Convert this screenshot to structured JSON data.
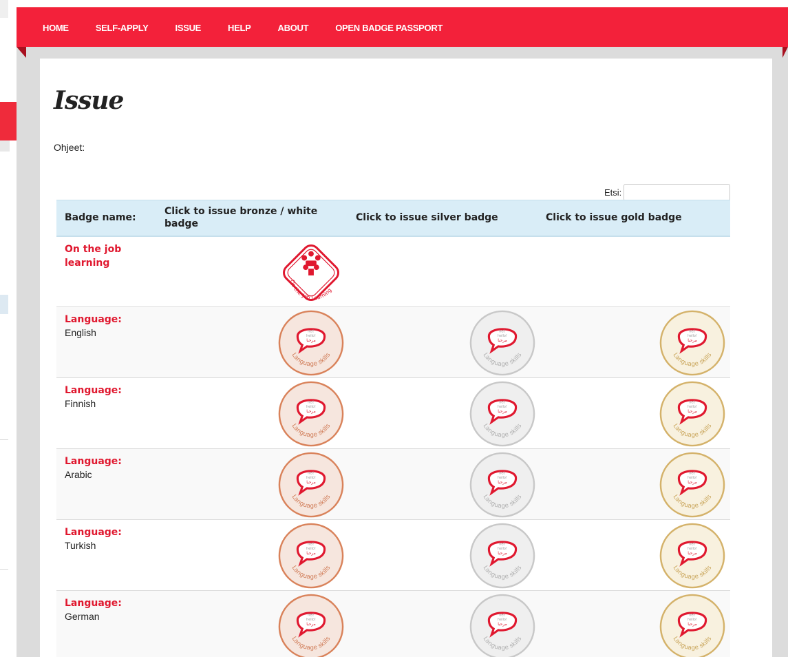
{
  "nav": {
    "items": [
      "HOME",
      "SELF-APPLY",
      "ISSUE",
      "HELP",
      "ABOUT",
      "OPEN BADGE PASSPORT"
    ]
  },
  "page": {
    "title": "Issue",
    "instructions_label": "Ohjeet:",
    "search_label": "Etsi:",
    "search_value": ""
  },
  "table": {
    "headers": [
      "Badge name:",
      "Click to issue bronze / white badge",
      "Click to issue silver badge",
      "Click to issue gold badge"
    ],
    "rows": [
      {
        "name": "On the job learning",
        "language": "",
        "badges": [
          "white"
        ],
        "badge_text": "On-the-Job Learning"
      },
      {
        "name": "Language:",
        "language": "English",
        "badges": [
          "bronze",
          "silver",
          "gold"
        ],
        "badge_text": "Language skills"
      },
      {
        "name": "Language:",
        "language": "Finnish",
        "badges": [
          "bronze",
          "silver",
          "gold"
        ],
        "badge_text": "Language skills"
      },
      {
        "name": "Language:",
        "language": "Arabic",
        "badges": [
          "bronze",
          "silver",
          "gold"
        ],
        "badge_text": "Language skills"
      },
      {
        "name": "Language:",
        "language": "Turkish",
        "badges": [
          "bronze",
          "silver",
          "gold"
        ],
        "badge_text": "Language skills"
      },
      {
        "name": "Language:",
        "language": "German",
        "badges": [
          "bronze",
          "silver",
          "gold"
        ],
        "badge_text": "Language skills"
      }
    ],
    "bubble_text": [
      "hei!",
      "hello!",
      "مرحبا"
    ]
  },
  "colors": {
    "nav_red": "#f3213a",
    "name_red": "#e0182f",
    "header_blue": "#d9edf7",
    "bronze": "#d9825a",
    "silver": "#c8c8c8",
    "gold": "#d4b26a"
  }
}
